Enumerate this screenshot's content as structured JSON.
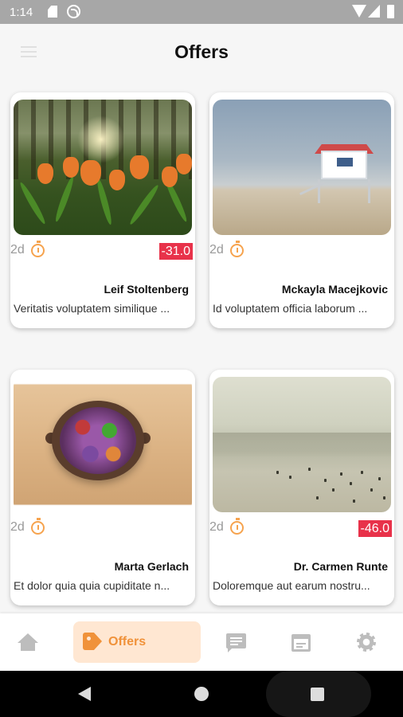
{
  "status_bar": {
    "time": "1:14",
    "icons": [
      "sd-card-icon",
      "sync-icon",
      "wifi-icon",
      "signal-icon",
      "battery-icon"
    ]
  },
  "header": {
    "title": "Offers",
    "menu_icon": "menu-icon"
  },
  "offers": [
    {
      "image": "tulips-forest",
      "time_left": "2d",
      "discount": "-31.0",
      "name": "Leif Stoltenberg",
      "description": "Veritatis voluptatem similique ..."
    },
    {
      "image": "beach-lifeguard-tower",
      "time_left": "2d",
      "discount": "",
      "name": "Mckayla Macejkovic",
      "description": "Id voluptatem officia laborum ..."
    },
    {
      "image": "salad-bowl",
      "time_left": "2d",
      "discount": "",
      "name": "Marta Gerlach",
      "description": "Et dolor quia quia cupiditate n..."
    },
    {
      "image": "hazy-beach",
      "time_left": "2d",
      "discount": "-46.0",
      "name": "Dr. Carmen Runte",
      "description": "Doloremque aut earum nostru..."
    }
  ],
  "bottom_nav": {
    "items": [
      {
        "icon": "home-icon",
        "label": ""
      },
      {
        "icon": "tag-icon",
        "label": "Offers",
        "active": true
      },
      {
        "icon": "chat-icon",
        "label": ""
      },
      {
        "icon": "calendar-icon",
        "label": ""
      },
      {
        "icon": "gear-icon",
        "label": ""
      }
    ]
  },
  "colors": {
    "accent": "#f0923a",
    "accent_bg": "#ffe7d2",
    "discount": "#e8324a",
    "status_bar": "#a7a7a7"
  }
}
